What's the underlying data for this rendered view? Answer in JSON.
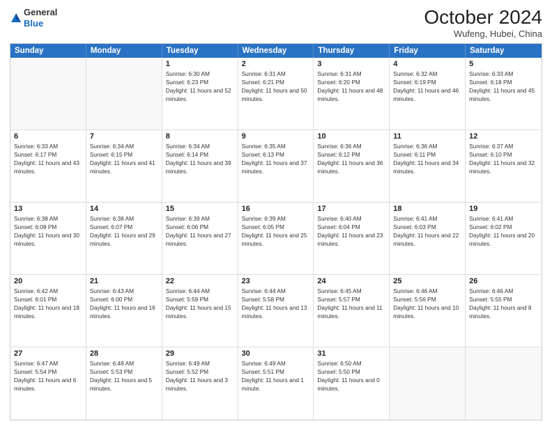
{
  "header": {
    "logo_general": "General",
    "logo_blue": "Blue",
    "main_title": "October 2024",
    "subtitle": "Wufeng, Hubei, China"
  },
  "calendar": {
    "weekdays": [
      "Sunday",
      "Monday",
      "Tuesday",
      "Wednesday",
      "Thursday",
      "Friday",
      "Saturday"
    ],
    "weeks": [
      [
        {
          "day": "",
          "info": ""
        },
        {
          "day": "",
          "info": ""
        },
        {
          "day": "1",
          "info": "Sunrise: 6:30 AM\nSunset: 6:23 PM\nDaylight: 11 hours and 52 minutes."
        },
        {
          "day": "2",
          "info": "Sunrise: 6:31 AM\nSunset: 6:21 PM\nDaylight: 11 hours and 50 minutes."
        },
        {
          "day": "3",
          "info": "Sunrise: 6:31 AM\nSunset: 6:20 PM\nDaylight: 11 hours and 48 minutes."
        },
        {
          "day": "4",
          "info": "Sunrise: 6:32 AM\nSunset: 6:19 PM\nDaylight: 11 hours and 46 minutes."
        },
        {
          "day": "5",
          "info": "Sunrise: 6:33 AM\nSunset: 6:18 PM\nDaylight: 11 hours and 45 minutes."
        }
      ],
      [
        {
          "day": "6",
          "info": "Sunrise: 6:33 AM\nSunset: 6:17 PM\nDaylight: 11 hours and 43 minutes."
        },
        {
          "day": "7",
          "info": "Sunrise: 6:34 AM\nSunset: 6:15 PM\nDaylight: 11 hours and 41 minutes."
        },
        {
          "day": "8",
          "info": "Sunrise: 6:34 AM\nSunset: 6:14 PM\nDaylight: 11 hours and 39 minutes."
        },
        {
          "day": "9",
          "info": "Sunrise: 6:35 AM\nSunset: 6:13 PM\nDaylight: 11 hours and 37 minutes."
        },
        {
          "day": "10",
          "info": "Sunrise: 6:36 AM\nSunset: 6:12 PM\nDaylight: 11 hours and 36 minutes."
        },
        {
          "day": "11",
          "info": "Sunrise: 6:36 AM\nSunset: 6:11 PM\nDaylight: 11 hours and 34 minutes."
        },
        {
          "day": "12",
          "info": "Sunrise: 6:37 AM\nSunset: 6:10 PM\nDaylight: 11 hours and 32 minutes."
        }
      ],
      [
        {
          "day": "13",
          "info": "Sunrise: 6:38 AM\nSunset: 6:08 PM\nDaylight: 11 hours and 30 minutes."
        },
        {
          "day": "14",
          "info": "Sunrise: 6:38 AM\nSunset: 6:07 PM\nDaylight: 11 hours and 29 minutes."
        },
        {
          "day": "15",
          "info": "Sunrise: 6:39 AM\nSunset: 6:06 PM\nDaylight: 11 hours and 27 minutes."
        },
        {
          "day": "16",
          "info": "Sunrise: 6:39 AM\nSunset: 6:05 PM\nDaylight: 11 hours and 25 minutes."
        },
        {
          "day": "17",
          "info": "Sunrise: 6:40 AM\nSunset: 6:04 PM\nDaylight: 11 hours and 23 minutes."
        },
        {
          "day": "18",
          "info": "Sunrise: 6:41 AM\nSunset: 6:03 PM\nDaylight: 11 hours and 22 minutes."
        },
        {
          "day": "19",
          "info": "Sunrise: 6:41 AM\nSunset: 6:02 PM\nDaylight: 11 hours and 20 minutes."
        }
      ],
      [
        {
          "day": "20",
          "info": "Sunrise: 6:42 AM\nSunset: 6:01 PM\nDaylight: 11 hours and 18 minutes."
        },
        {
          "day": "21",
          "info": "Sunrise: 6:43 AM\nSunset: 6:00 PM\nDaylight: 11 hours and 16 minutes."
        },
        {
          "day": "22",
          "info": "Sunrise: 6:44 AM\nSunset: 5:59 PM\nDaylight: 11 hours and 15 minutes."
        },
        {
          "day": "23",
          "info": "Sunrise: 6:44 AM\nSunset: 5:58 PM\nDaylight: 11 hours and 13 minutes."
        },
        {
          "day": "24",
          "info": "Sunrise: 6:45 AM\nSunset: 5:57 PM\nDaylight: 11 hours and 11 minutes."
        },
        {
          "day": "25",
          "info": "Sunrise: 6:46 AM\nSunset: 5:56 PM\nDaylight: 11 hours and 10 minutes."
        },
        {
          "day": "26",
          "info": "Sunrise: 6:46 AM\nSunset: 5:55 PM\nDaylight: 11 hours and 8 minutes."
        }
      ],
      [
        {
          "day": "27",
          "info": "Sunrise: 6:47 AM\nSunset: 5:54 PM\nDaylight: 11 hours and 6 minutes."
        },
        {
          "day": "28",
          "info": "Sunrise: 6:48 AM\nSunset: 5:53 PM\nDaylight: 11 hours and 5 minutes."
        },
        {
          "day": "29",
          "info": "Sunrise: 6:49 AM\nSunset: 5:52 PM\nDaylight: 11 hours and 3 minutes."
        },
        {
          "day": "30",
          "info": "Sunrise: 6:49 AM\nSunset: 5:51 PM\nDaylight: 11 hours and 1 minute."
        },
        {
          "day": "31",
          "info": "Sunrise: 6:50 AM\nSunset: 5:50 PM\nDaylight: 11 hours and 0 minutes."
        },
        {
          "day": "",
          "info": ""
        },
        {
          "day": "",
          "info": ""
        }
      ]
    ]
  }
}
